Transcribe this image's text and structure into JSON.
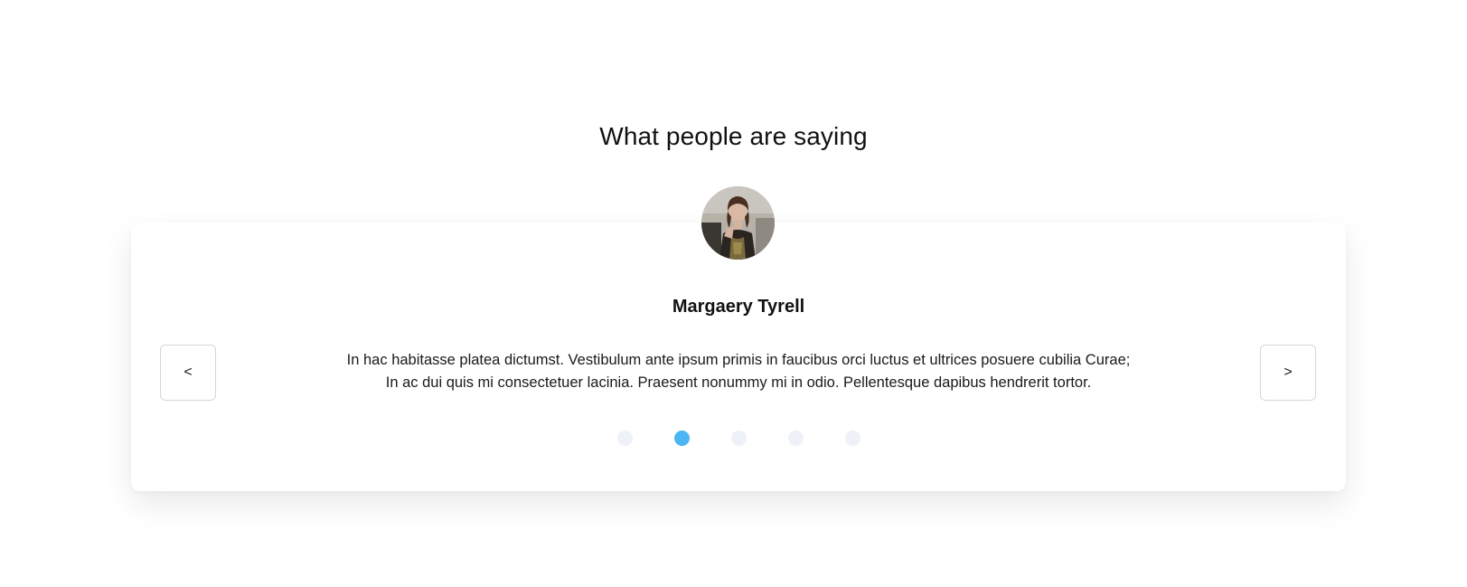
{
  "section": {
    "title": "What people are saying"
  },
  "testimonial": {
    "name": "Margaery Tyrell",
    "quote": "In hac habitasse platea dictumst. Vestibulum ante ipsum primis in faucibus orci luctus et ultrices posuere cubilia Curae; In ac dui quis mi consectetuer lacinia. Praesent nonummy mi in odio. Pellentesque dapibus hendrerit tortor."
  },
  "nav": {
    "prev_label": "<",
    "next_label": ">"
  },
  "pagination": {
    "count": 5,
    "active_index": 1
  },
  "colors": {
    "dot_active": "#4bb6f4",
    "dot_inactive": "#eef1f7"
  }
}
